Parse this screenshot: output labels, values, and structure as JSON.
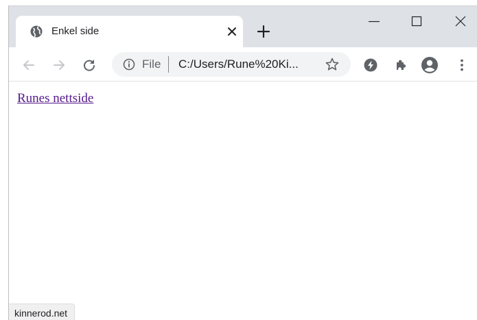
{
  "tab": {
    "title": "Enkel side",
    "favicon": "globe-icon"
  },
  "window_controls": [
    "minimize-icon",
    "maximize-icon",
    "close-icon"
  ],
  "toolbar": {
    "back": "back-arrow-icon",
    "forward": "forward-arrow-icon",
    "reload": "reload-icon",
    "address": {
      "info_icon": "info-icon",
      "scheme_label": "File",
      "url": "C:/Users/Rune%20Ki...",
      "bookmark": "star-icon"
    },
    "extensions": [
      "bolt-extension-icon",
      "puzzle-extensions-icon"
    ],
    "account": "account-icon",
    "menu": "more-vert-icon"
  },
  "page": {
    "link_text": "Runes nettside"
  },
  "status": {
    "hover_url": "kinnerod.net"
  },
  "colors": {
    "tabstrip": "#dee1e6",
    "omnibox": "#f1f3f4",
    "visited_link": "#551a8b",
    "icon": "#5f6368"
  }
}
